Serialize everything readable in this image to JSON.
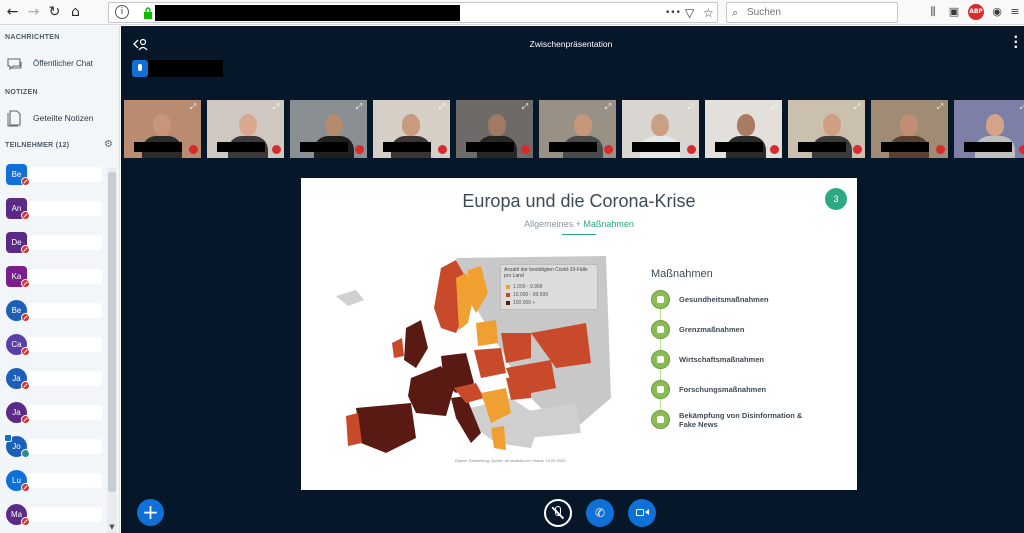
{
  "browser": {
    "search_placeholder": "Suchen",
    "info_icon": "i",
    "more_dots": "•••",
    "abp_label": "ABP"
  },
  "sidebar": {
    "messages_title": "NACHRICHTEN",
    "public_chat_label": "Öffentlicher Chat",
    "notes_title": "NOTIZEN",
    "shared_notes_label": "Geteilte Notizen",
    "participants_title": "TEILNEHMER (12)",
    "users": [
      {
        "initials": "Be",
        "color": "#0f70d7",
        "shape": "sq",
        "status": "muted"
      },
      {
        "initials": "An",
        "color": "#5b2a86",
        "shape": "sq",
        "status": "muted"
      },
      {
        "initials": "De",
        "color": "#5b2a86",
        "shape": "sq",
        "status": "muted"
      },
      {
        "initials": "Ka",
        "color": "#7a1f8a",
        "shape": "sq",
        "status": "muted"
      },
      {
        "initials": "Be",
        "color": "#1c5fb8",
        "shape": "ci",
        "status": "muted"
      },
      {
        "initials": "Ca",
        "color": "#5b3fa8",
        "shape": "ci",
        "status": "muted"
      },
      {
        "initials": "Ja",
        "color": "#1c5fb8",
        "shape": "ci",
        "status": "muted"
      },
      {
        "initials": "Ja",
        "color": "#5b2a86",
        "shape": "ci",
        "status": "muted"
      },
      {
        "initials": "Jo",
        "color": "#1c5fb8",
        "shape": "ci",
        "status": "joined",
        "presenter": true
      },
      {
        "initials": "Lu",
        "color": "#0f70d7",
        "shape": "ci",
        "status": "muted"
      },
      {
        "initials": "Ma",
        "color": "#5b2a86",
        "shape": "ci",
        "status": "muted"
      }
    ]
  },
  "main": {
    "presentation_title": "Zwischenpräsentation",
    "video_tiles": [
      {
        "wall": "#b98c72",
        "skin": "#c9957a",
        "cloth": "#2b2b2b"
      },
      {
        "wall": "#cfc9c2",
        "skin": "#d8a98e",
        "cloth": "#3a3a3a"
      },
      {
        "wall": "#8a8f93",
        "skin": "#b58b70",
        "cloth": "#1f1f1f"
      },
      {
        "wall": "#d6cfc6",
        "skin": "#c99a7e",
        "cloth": "#3e3532"
      },
      {
        "wall": "#6e6a67",
        "skin": "#a07a62",
        "cloth": "#262626"
      },
      {
        "wall": "#9a9186",
        "skin": "#c7977a",
        "cloth": "#4a4a4a"
      },
      {
        "wall": "#d9d6d2",
        "skin": "#caa085",
        "cloth": "#e6e6e6"
      },
      {
        "wall": "#e3e0dc",
        "skin": "#a97c62",
        "cloth": "#2a2a2a"
      },
      {
        "wall": "#cbbfae",
        "skin": "#cf9f84",
        "cloth": "#3a3a3a"
      },
      {
        "wall": "#a08b74",
        "skin": "#c08e72",
        "cloth": "#5a4030"
      },
      {
        "wall": "#7d7fa6",
        "skin": "#d3a489",
        "cloth": "#bfbfbf"
      }
    ]
  },
  "slide": {
    "title": "Europa und die Corona-Krise",
    "number": "3",
    "subtitle_plain": "Allgemeines + ",
    "subtitle_highlight": "Maßnahmen",
    "legend_title": "Anzahl der bestätigten Covid-19-Fälle pro Land",
    "legend": [
      {
        "label": "1.000 - 9.999",
        "color": "#f0a030"
      },
      {
        "label": "10.000 - 99.999",
        "color": "#c84a2a"
      },
      {
        "label": "100.000 +",
        "color": "#5a1a14"
      }
    ],
    "credit": "Eigene Darstellung, Quelle: de.statista.com Stand: 15.05.2020",
    "measures_title": "Maßnahmen",
    "measures": [
      "Gesundheitsmaßnahmen",
      "Grenzmaßnahmen",
      "Wirtschaftsmaßnahmen",
      "Forschungsmaßnahmen",
      "Bekämpfung von Disinformation & Fake News"
    ]
  }
}
